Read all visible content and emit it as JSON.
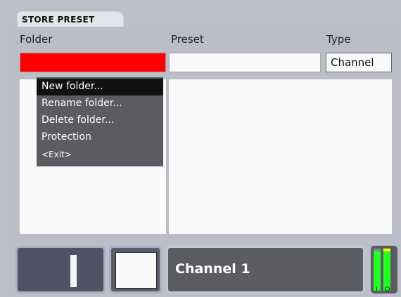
{
  "tab": {
    "title": "Store Preset"
  },
  "columns": {
    "folder": "Folder",
    "preset": "Preset",
    "type": "Type"
  },
  "type_field": {
    "value": "Channel"
  },
  "folder_field": {
    "value": ""
  },
  "preset_field": {
    "value": ""
  },
  "menu": {
    "items": [
      {
        "label": "New folder...",
        "selected": true
      },
      {
        "label": "Rename folder..."
      },
      {
        "label": "Delete folder..."
      },
      {
        "label": "Protection"
      },
      {
        "label": "<Exit>"
      }
    ]
  },
  "bottom": {
    "channel_label": "Channel 1"
  },
  "colors": {
    "folder_field": "#ff0000",
    "meter_level": "#22ff22",
    "meter_peak": "#ffff00"
  }
}
